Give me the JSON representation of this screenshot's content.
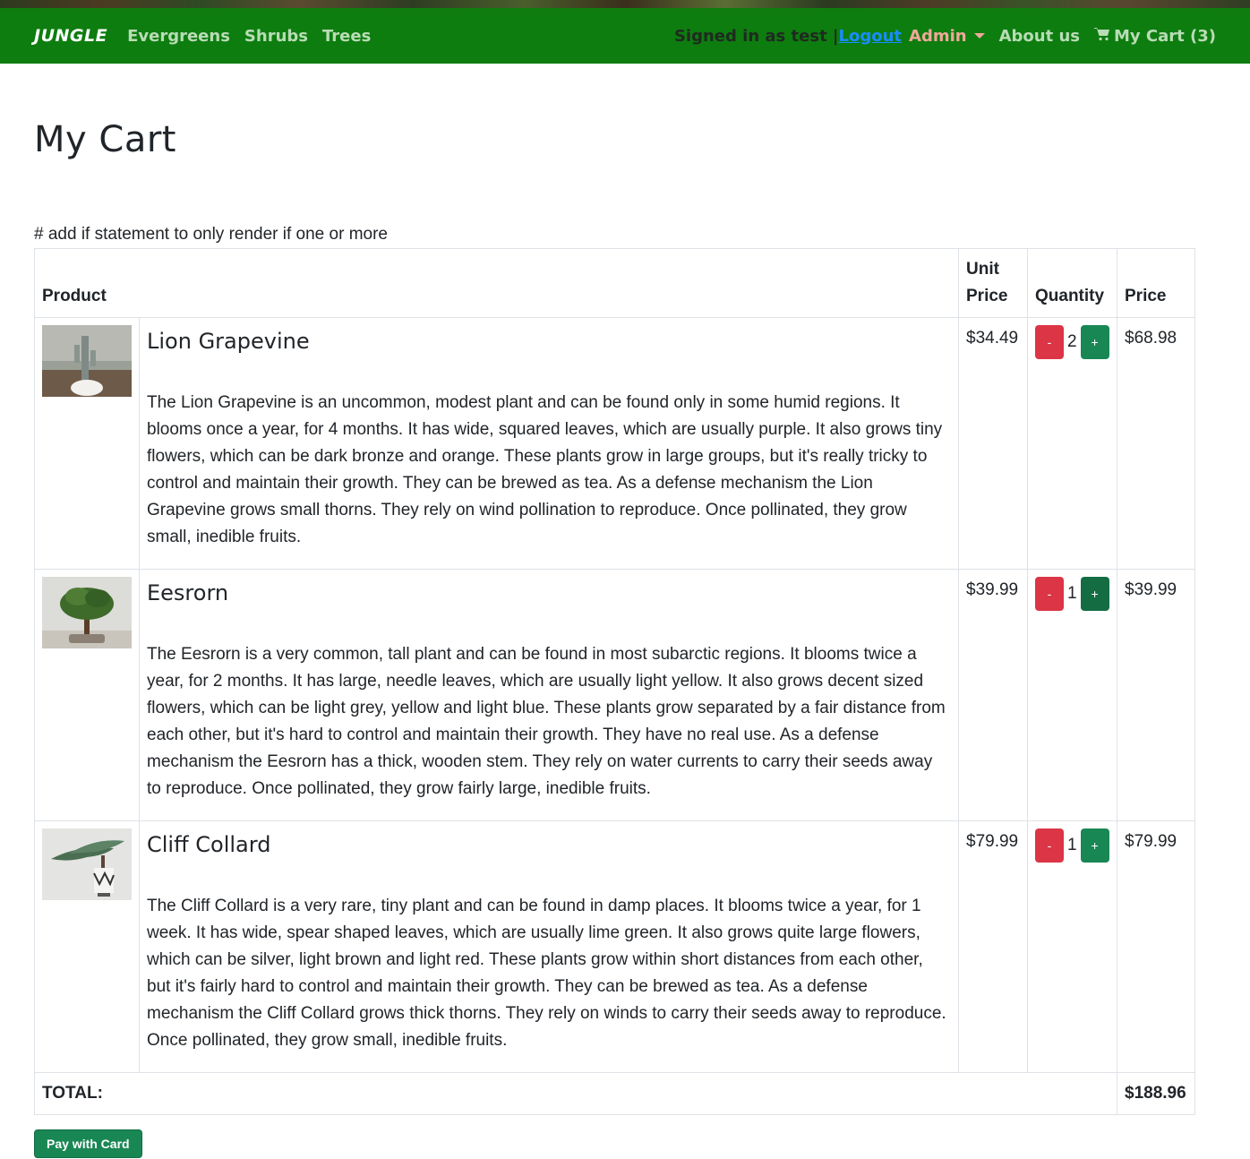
{
  "nav": {
    "brand": "JUNGLE",
    "links": [
      "Evergreens",
      "Shrubs",
      "Trees"
    ],
    "signed_in": "Signed in as test |",
    "logout": "Logout",
    "admin": "Admin",
    "about": "About us",
    "cart": "My Cart (3)"
  },
  "page": {
    "title": "My Cart",
    "note": "# add if statement to only render if one or more"
  },
  "table": {
    "headers": {
      "product": "Product",
      "unit_price": "Unit Price",
      "quantity": "Quantity",
      "price": "Price"
    },
    "items": [
      {
        "name": "Lion Grapevine",
        "description": "The Lion Grapevine is an uncommon, modest plant and can be found only in some humid regions. It blooms once a year, for 4 months. It has wide, squared leaves, which are usually purple. It also grows tiny flowers, which can be dark bronze and orange. These plants grow in large groups, but it's really tricky to control and maintain their growth. They can be brewed as tea. As a defense mechanism the Lion Grapevine grows small thorns. They rely on wind pollination to reproduce. Once pollinated, they grow small, inedible fruits.",
        "unit_price": "$34.49",
        "quantity": "2",
        "price": "$68.98",
        "image": "cactus-plant-photo"
      },
      {
        "name": "Eesrorn",
        "description": "The Eesrorn is a very common, tall plant and can be found in most subarctic regions. It blooms twice a year, for 2 months. It has large, needle leaves, which are usually light yellow. It also grows decent sized flowers, which can be light grey, yellow and light blue. These plants grow separated by a fair distance from each other, but it's hard to control and maintain their growth. They have no real use. As a defense mechanism the Eesrorn has a thick, wooden stem. They rely on water currents to carry their seeds away to reproduce. Once pollinated, they grow fairly large, inedible fruits.",
        "unit_price": "$39.99",
        "quantity": "1",
        "price": "$39.99",
        "image": "bonsai-tree-photo"
      },
      {
        "name": "Cliff Collard",
        "description": "The Cliff Collard is a very rare, tiny plant and can be found in damp places. It blooms twice a year, for 1 week. It has wide, spear shaped leaves, which are usually lime green. It also grows quite large flowers, which can be silver, light brown and light red. These plants grow within short distances from each other, but it's fairly hard to control and maintain their growth. They can be brewed as tea. As a defense mechanism the Cliff Collard grows thick thorns. They rely on winds to carry their seeds away to reproduce. Once pollinated, they grow small, inedible fruits.",
        "unit_price": "$79.99",
        "quantity": "1",
        "price": "$79.99",
        "image": "juniper-bonsai-photo"
      }
    ],
    "minus_label": "-",
    "plus_label": "+",
    "total_label": "TOTAL:",
    "total_value": "$188.96"
  },
  "pay_button": "Pay with Card",
  "colors": {
    "navbar": "#0d7d0f",
    "minus_button": "#dc3545",
    "plus_button": "#198754",
    "logout_link": "#1a8cff",
    "admin_link": "#f0a89a"
  }
}
